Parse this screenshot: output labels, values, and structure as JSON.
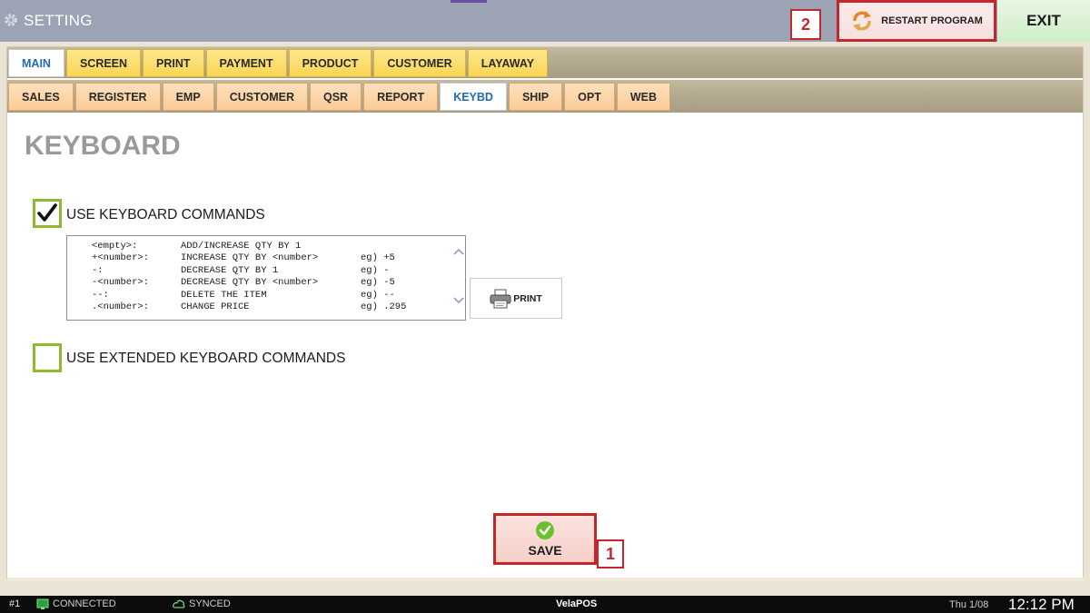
{
  "window": {
    "title": "SETTING"
  },
  "header": {
    "restart_label": "RESTART PROGRAM",
    "exit_label": "EXIT",
    "annotation_2": "2"
  },
  "tabs_main": [
    {
      "label": "MAIN",
      "active": true
    },
    {
      "label": "SCREEN",
      "active": false
    },
    {
      "label": "PRINT",
      "active": false
    },
    {
      "label": "PAYMENT",
      "active": false
    },
    {
      "label": "PRODUCT",
      "active": false
    },
    {
      "label": "CUSTOMER",
      "active": false
    },
    {
      "label": "LAYAWAY",
      "active": false
    }
  ],
  "tabs_sub": [
    {
      "label": "SALES",
      "active": false
    },
    {
      "label": "REGISTER",
      "active": false
    },
    {
      "label": "EMP",
      "active": false
    },
    {
      "label": "CUSTOMER",
      "active": false
    },
    {
      "label": "QSR",
      "active": false
    },
    {
      "label": "REPORT",
      "active": false
    },
    {
      "label": "KEYBD",
      "active": true
    },
    {
      "label": "SHIP",
      "active": false
    },
    {
      "label": "OPT",
      "active": false
    },
    {
      "label": "WEB",
      "active": false
    }
  ],
  "page": {
    "heading": "KEYBOARD",
    "use_keyboard_commands": {
      "label": "USE KEYBOARD COMMANDS",
      "checked": true
    },
    "use_extended_commands": {
      "label": "USE EXTENDED KEYBOARD COMMANDS",
      "checked": false
    },
    "commands": [
      {
        "key": "<empty>:",
        "desc": "ADD/INCREASE QTY BY 1",
        "example": ""
      },
      {
        "key": "+<number>:",
        "desc": "INCREASE QTY BY <number>",
        "example": "eg) +5"
      },
      {
        "key": "-:",
        "desc": "DECREASE QTY BY 1",
        "example": "eg) -"
      },
      {
        "key": "-<number>:",
        "desc": "DECREASE QTY BY <number>",
        "example": "eg) -5"
      },
      {
        "key": "--:",
        "desc": "DELETE THE ITEM",
        "example": "eg) --"
      },
      {
        "key": ".<number>:",
        "desc": "CHANGE PRICE",
        "example": "eg) .295"
      }
    ],
    "print_label": "PRINT",
    "save_label": "SAVE",
    "annotation_1": "1"
  },
  "statusbar": {
    "terminal": "#1",
    "connection": "CONNECTED",
    "sync": "SYNCED",
    "app_name": "VelaPOS",
    "date": "Thu 1/08",
    "time": "12:12 PM"
  },
  "colors": {
    "accent_red": "#c4262e",
    "checkbox_green": "#92b832",
    "tab_main": "#fbd654",
    "tab_sub": "#fbcc96",
    "active_tab_text": "#1f69b5"
  }
}
